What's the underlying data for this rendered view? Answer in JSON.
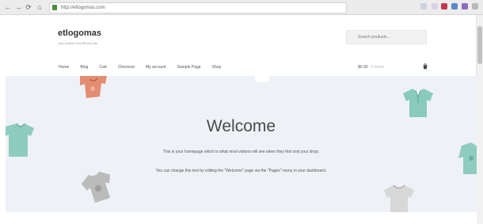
{
  "browser": {
    "back_glyph": "←",
    "forward_glyph": "→",
    "reload_glyph": "⟳",
    "address": "http://etlogomas.com"
  },
  "site": {
    "title": "etlogomas",
    "tagline": "Just another WordPress site"
  },
  "search": {
    "placeholder": "Search products…"
  },
  "nav": {
    "items": [
      "Home",
      "Blog",
      "Cart",
      "Checkout",
      "My account",
      "Sample Page",
      "Shop"
    ]
  },
  "cart": {
    "total": "$0.00",
    "count": "0 items"
  },
  "hero": {
    "title": "Welcome",
    "line1": "This is your homepage which is what most visitors will see when they first visit your shop.",
    "line2": "You can change this text by editing the \"Welcome\" page via the \"Pages\" menu in your dashboard."
  },
  "icons": {
    "search": "search-icon",
    "cart": "cart-icon",
    "lock": "lock-icon"
  },
  "colors": {
    "hero_bg": "#eef1f5",
    "shirt_orange": "#e07b5c",
    "shirt_teal": "#7cc6b6",
    "shirt_gray": "#b5b5b5"
  }
}
